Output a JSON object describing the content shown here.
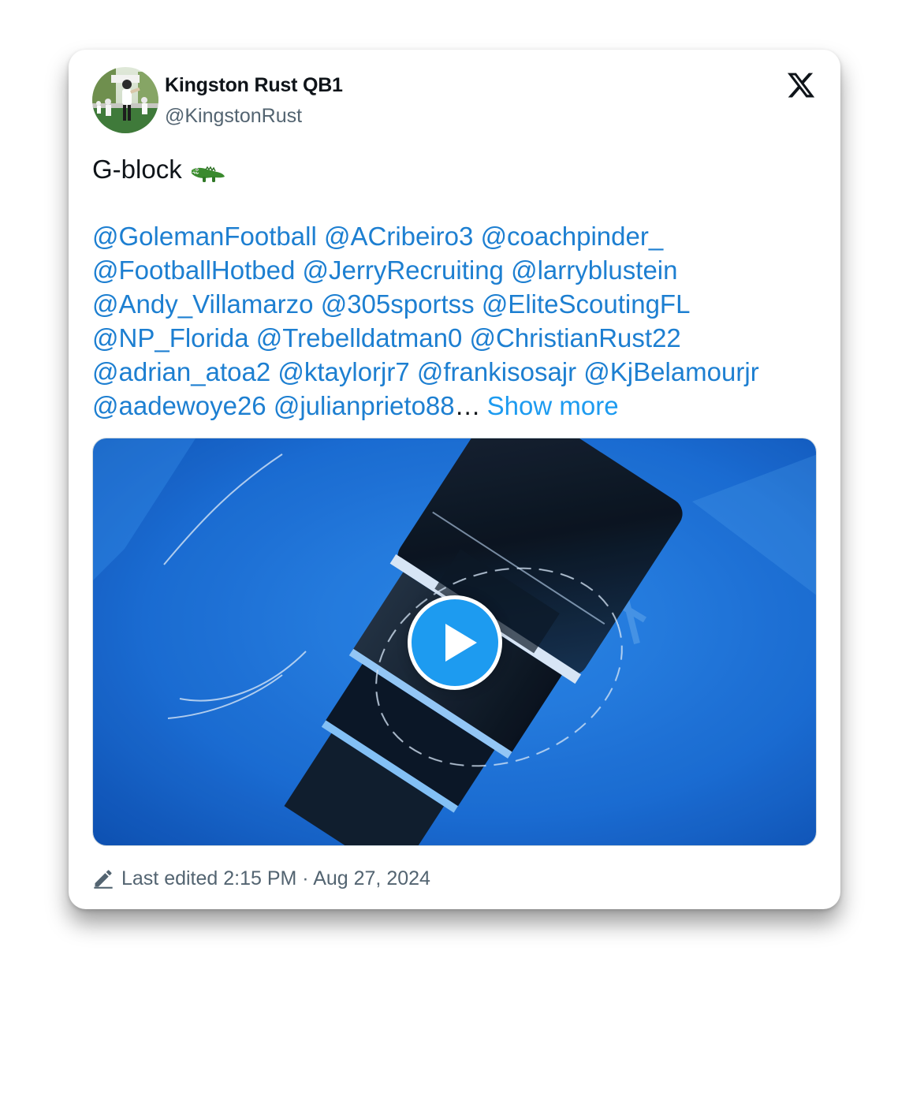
{
  "author": {
    "display_name": "Kingston Rust QB1",
    "handle": "@KingstonRust",
    "avatar_icon": "avatar-photo"
  },
  "platform": {
    "logo_icon": "x-logo-icon"
  },
  "tweet": {
    "text": "G-block",
    "emoji_icon": "crocodile-emoji",
    "mention_lines": [
      [
        "@GolemanFootball",
        "@ACribeiro3",
        "@coachpinder_"
      ],
      [
        "@FootballHotbed",
        "@JerryRecruiting",
        "@larryblustein"
      ],
      [
        "@Andy_Villamarzo",
        "@305sportss",
        "@EliteScoutingFL"
      ],
      [
        "@NP_Florida",
        "@Trebelldatman0",
        "@ChristianRust22"
      ],
      [
        "@adrian_atoa2",
        "@ktaylorjr7",
        "@frankisosajr",
        "@KjBelamourjr"
      ],
      [
        "@aadewoye26",
        "@julianprieto88"
      ]
    ],
    "ellipsis": "…",
    "show_more_label": "Show more"
  },
  "media": {
    "type": "video",
    "play_icon": "play-icon"
  },
  "footer": {
    "edit_icon": "pencil-icon",
    "edited_text": "Last edited 2:15 PM · Aug 27, 2024"
  },
  "colors": {
    "link": "#1d7fd1",
    "show_more": "#1d9bf0",
    "text": "#0f1419",
    "muted": "#536471",
    "play_button": "#1d9bf0"
  }
}
